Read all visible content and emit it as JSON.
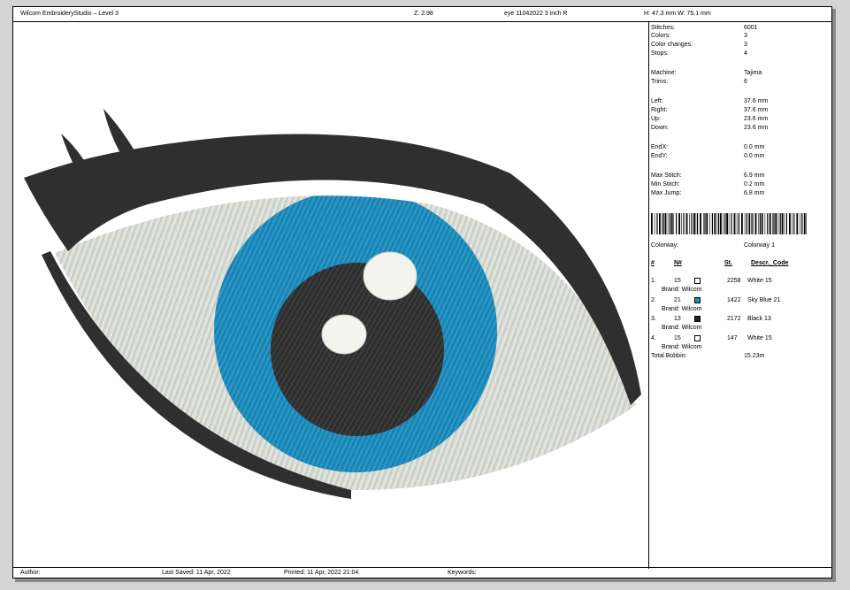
{
  "header": {
    "app": "Wilcom EmbroideryStudio – Level 3",
    "zoom": "Z: 2.98",
    "design_name": "eye 11042022 3 inch R",
    "size": "H: 47.3 mm   W: 75.1 mm"
  },
  "stats": [
    {
      "label": "Stitches:",
      "value": "6001"
    },
    {
      "label": "Colors:",
      "value": "3"
    },
    {
      "label": "Color changes:",
      "value": "3"
    },
    {
      "label": "Stops:",
      "value": "4"
    },
    {
      "label": "Machine:",
      "value": "Tajima"
    },
    {
      "label": "Trims:",
      "value": "6"
    },
    {
      "label": "Left:",
      "value": "37.6 mm"
    },
    {
      "label": "Right:",
      "value": "37.6 mm"
    },
    {
      "label": "Up:",
      "value": "23.6 mm"
    },
    {
      "label": "Down:",
      "value": "23.6 mm"
    },
    {
      "label": "EndX:",
      "value": "0.0 mm"
    },
    {
      "label": "EndY:",
      "value": "0.0 mm"
    },
    {
      "label": "Max Stitch:",
      "value": "6.9 mm"
    },
    {
      "label": "Min Stitch:",
      "value": "0.2 mm"
    },
    {
      "label": "Max Jump:",
      "value": "6.8 mm"
    }
  ],
  "colorway": {
    "label": "Colorway:",
    "value": "Colorway 1"
  },
  "table_headers": {
    "num": "#",
    "n": "N#",
    "st": "St.",
    "desc": "Descr._Code"
  },
  "threads": [
    {
      "idx": "1.",
      "n": "15",
      "color": "#ffffff",
      "st": "2258",
      "desc": "White 15",
      "brand": "Brand: Wilcom"
    },
    {
      "idx": "2.",
      "n": "21",
      "color": "#1e8ec0",
      "st": "1422",
      "desc": "Sky Blue 21",
      "brand": "Brand: Wilcom"
    },
    {
      "idx": "3.",
      "n": "13",
      "color": "#222222",
      "st": "2172",
      "desc": "Black 13",
      "brand": "Brand: Wilcom"
    },
    {
      "idx": "4.",
      "n": "15",
      "color": "#ffffff",
      "st": "147",
      "desc": "White 15",
      "brand": "Brand: Wilcom"
    }
  ],
  "bobbin": {
    "label": "Total Bobbin:",
    "value": "15.23m"
  },
  "footer": {
    "author": "Author:",
    "saved": "Last Saved: 11 Apr, 2022",
    "printed": "Printed: 11 Apr, 2022 21:04",
    "keywords": "Keywords:"
  },
  "colors": {
    "outline": "#2f2f2f",
    "sclera": "#d9dcd5",
    "iris": "#1f8dbd",
    "pupil": "#343434",
    "highlight": "#f4f4ef"
  }
}
